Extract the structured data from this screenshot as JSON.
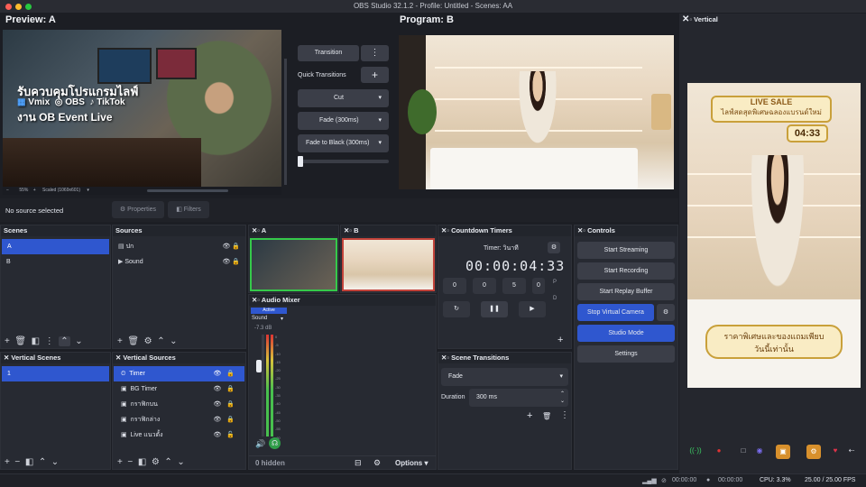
{
  "window": {
    "title": "OBS Studio 32.1.2 - Profile: Untitled - Scenes: AA"
  },
  "preview": {
    "label": "Preview: A",
    "overlay_line1": "รับควบคุมโปรแกรมไลฟ์",
    "overlay_vmix": "Vmix",
    "overlay_obs": "OBS",
    "overlay_tiktok": "TikTok",
    "overlay_line3": "งาน OB Event Live",
    "zoom": "55%",
    "scale": "Scaled (1069x601)"
  },
  "program": {
    "label": "Program: B"
  },
  "transitions": {
    "transition": "Transition",
    "quick": "Quick Transitions",
    "items": [
      "Cut",
      "Fade (300ms)",
      "Fade to Black (300ms)"
    ]
  },
  "vertical": {
    "title": "Vertical",
    "live_sale": "LIVE SALE",
    "live_sub": "ไลฟ์สดสุดพิเศษฉลองแบรนด์ใหม่",
    "timer": "04:33",
    "bottom1": "ราคาพิเศษและของแถมเพียบ",
    "bottom2": "วันนี้เท่านั้น"
  },
  "status": {
    "no_source": "No source selected",
    "properties": "Properties",
    "filters": "Filters"
  },
  "scenes": {
    "title": "Scenes",
    "items": [
      "A",
      "B"
    ]
  },
  "sources": {
    "title": "Sources",
    "items": [
      "ปก",
      "Sound"
    ]
  },
  "vscenes": {
    "title": "Vertical Scenes",
    "items": [
      "1"
    ]
  },
  "vsources": {
    "title": "Vertical Sources",
    "items": [
      "Timer",
      "BG Timer",
      "กราฟิกบน",
      "กราฟิกล่าง",
      "Live แนวตั้ง"
    ]
  },
  "multi": {
    "a": "A",
    "b": "B"
  },
  "mixer": {
    "title": "Audio Mixer",
    "active": "Active",
    "source": "Sound",
    "db": "-7.3 dB",
    "ticks": [
      "0",
      "-5",
      "-10",
      "-15",
      "-20",
      "-25",
      "-30",
      "-35",
      "-40",
      "-45",
      "-50",
      "-55",
      "-60"
    ],
    "hidden": "0 hidden",
    "options": "Options"
  },
  "countdown": {
    "title": "Countdown Timers",
    "timer_label": "Timer: วินาที",
    "display": "00:00:04:33",
    "fields": [
      "0",
      "0",
      "5",
      "0"
    ],
    "p": "P",
    "d": "D"
  },
  "scene_trans": {
    "title": "Scene Transitions",
    "selected": "Fade",
    "duration_label": "Duration",
    "duration": "300 ms"
  },
  "controls": {
    "title": "Controls",
    "buttons": [
      "Start Streaming",
      "Start Recording",
      "Start Replay Buffer",
      "Stop Virtual Camera",
      "Studio Mode",
      "Settings"
    ]
  },
  "statusbar": {
    "t1": "00:00:00",
    "t2": "00:00:00",
    "cpu": "CPU: 3.3%",
    "fps": "25.00 / 25.00 FPS"
  },
  "colors": {
    "accent": "#2f57cf",
    "bg": "#1c1e24",
    "dock": "#272a32"
  }
}
